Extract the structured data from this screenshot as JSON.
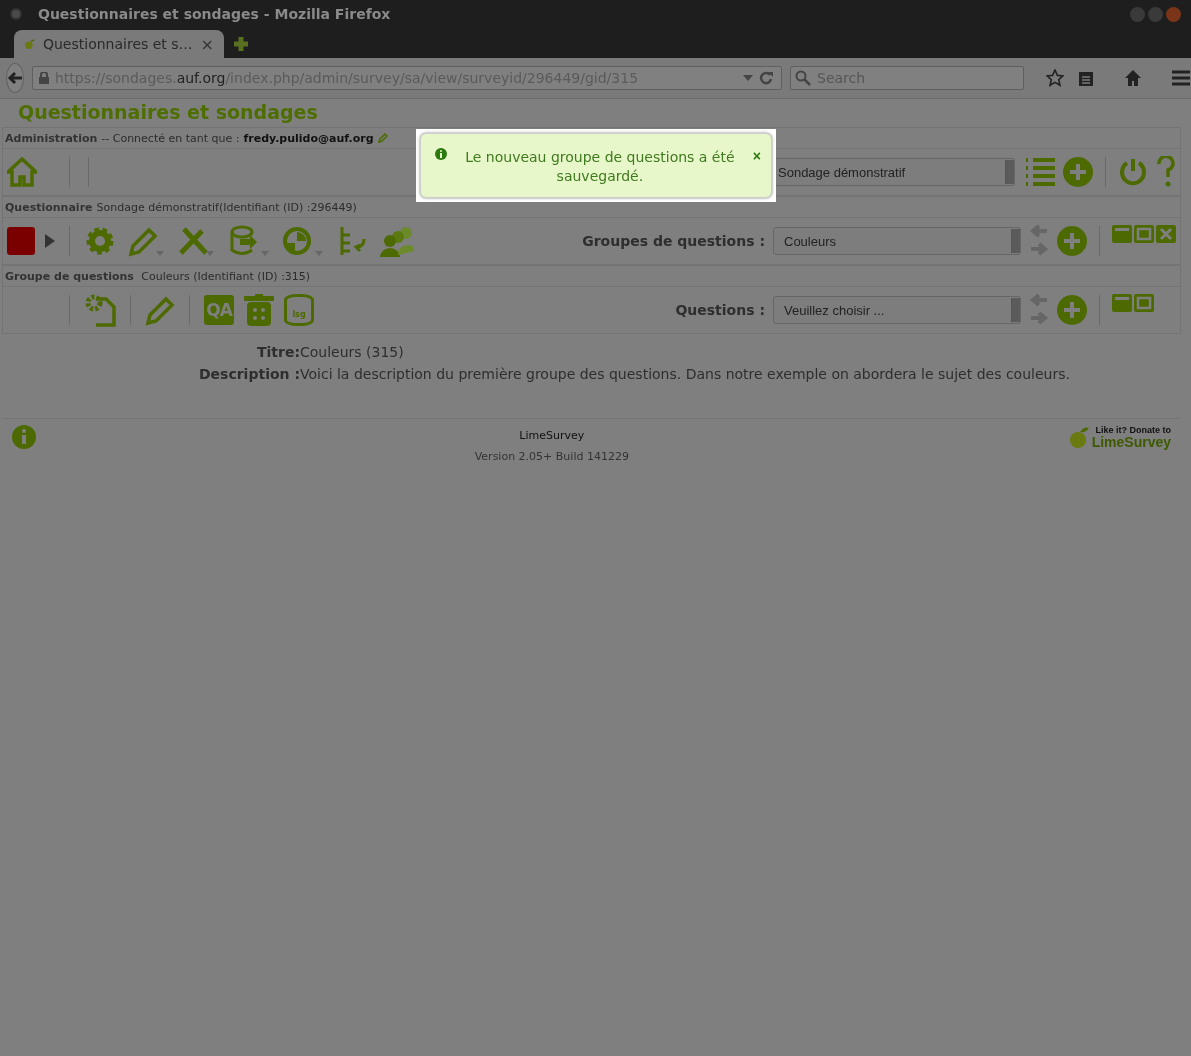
{
  "window": {
    "title": "Questionnaires et sondages - Mozilla Firefox"
  },
  "tabs": [
    {
      "label": "Questionnaires et s…",
      "selected": true,
      "close": "×"
    }
  ],
  "address_bar": {
    "url": "https://sondages.**auf.org**/index.php/admin/survey/sa/view/surveyid/296449/gid/315"
  },
  "search": {
    "placeholder": "Search"
  },
  "page_title": "Questionnaires et sondages",
  "admin_bar": {
    "label": "Administration",
    "text": "-- Connecté en tant que :",
    "user": "fredy.pulido@auf.org",
    "survey_select": "Sondage démonstratif"
  },
  "survey_bar": {
    "label": "Questionnaire",
    "text": "Sondage démonstratif(Identifiant (ID) :296449)",
    "groups_label": "Groupes de questions :",
    "groups_select": "Couleurs"
  },
  "group_bar": {
    "label": "Groupe de questions",
    "text": "Couleurs (Identifiant (ID) :315)",
    "qa_icon": "QA",
    "lsg_icon": "lsg",
    "questions_label": "Questions :",
    "questions_select": "Veuillez choisir ..."
  },
  "details": [
    {
      "label": "Titre:",
      "value": "Couleurs (315)"
    },
    {
      "label": "Description :",
      "value": "Voici la description du première groupe des questions. Dans notre exemple on abordera le sujet des  couleurs."
    }
  ],
  "footer": {
    "name": "LimeSurvey",
    "version": "Version 2.05+ Build 141229",
    "donate_text": "Like it? Donate to",
    "donate_brand": "LimeSurvey"
  },
  "notification": {
    "message": "Le nouveau groupe de questions a été sauvegardé.",
    "close": "×"
  }
}
